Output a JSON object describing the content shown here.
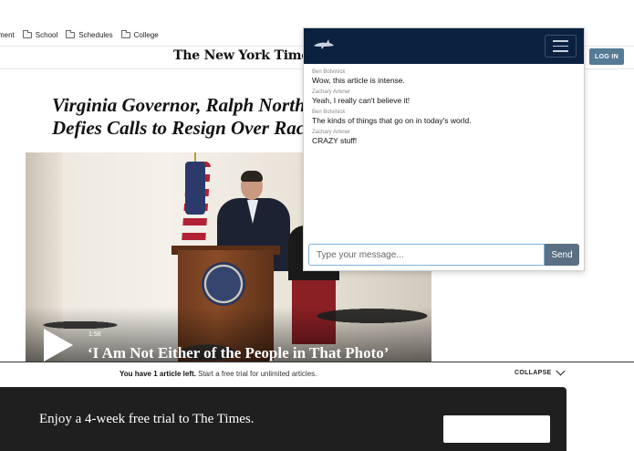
{
  "bookmarks": [
    {
      "label": "ment"
    },
    {
      "label": "School"
    },
    {
      "label": "Schedules"
    },
    {
      "label": "College"
    }
  ],
  "site": {
    "masthead": "The New York Times",
    "login_label": "LOG IN"
  },
  "article": {
    "headline_line1": "Virginia Governor, Ralph Northam,",
    "headline_line2": "Defies Calls to Resign Over Racist",
    "video_duration": "1:58",
    "video_caption": "‘I Am Not Either of the People in That Photo’"
  },
  "meter": {
    "bold_text": "You have 1 article left.",
    "rest_text": " Start a free trial for unlimited articles.",
    "collapse_label": "COLLAPSE"
  },
  "trial": {
    "text": "Enjoy a 4-week free trial to The Times."
  },
  "chat": {
    "messages": [
      {
        "author": "Ben Botvinick",
        "text": "Wow, this article is intense."
      },
      {
        "author": "Zachary Ankner",
        "text": "Yeah, I really can't believe it!"
      },
      {
        "author": "Ben Botvinick",
        "text": "The kinds of things that go on in today's world."
      },
      {
        "author": "Zachary Ankner",
        "text": "CRAZY stuff!"
      }
    ],
    "input_placeholder": "Type your message...",
    "input_value": "",
    "send_label": "Send"
  },
  "colors": {
    "chat_header": "#0b2140",
    "send_button": "#5a6f83",
    "login_button": "#567b95"
  }
}
